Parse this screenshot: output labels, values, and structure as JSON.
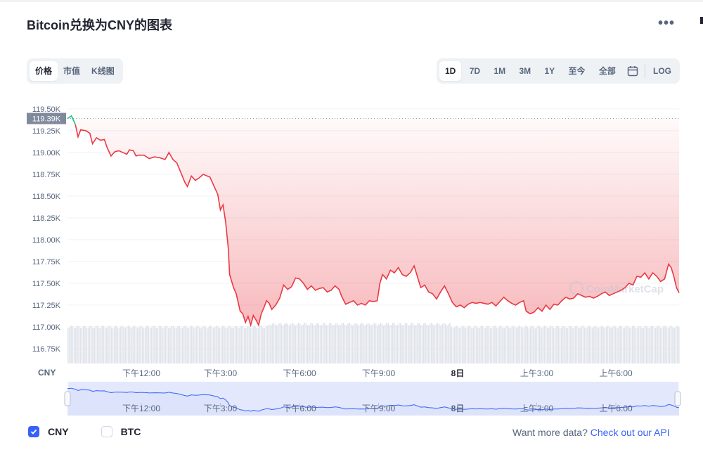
{
  "title": "Bitcoin兑换为CNY的图表",
  "menu_icon": "more-horizontal-icon",
  "metric_tabs": [
    "价格",
    "市值",
    "K线图"
  ],
  "active_metric": "价格",
  "range_tabs": [
    "1D",
    "7D",
    "1M",
    "3M",
    "1Y",
    "至今",
    "全部"
  ],
  "active_range": "1D",
  "calendar_icon": "calendar-icon",
  "log_label": "LOG",
  "chart_data": {
    "type": "area",
    "currency_label": "CNY",
    "y_ticks": [
      "119.50K",
      "119.25K",
      "119.00K",
      "118.75K",
      "118.50K",
      "118.25K",
      "118.00K",
      "117.75K",
      "117.50K",
      "117.25K",
      "117.00K",
      "116.75K"
    ],
    "ylim": [
      116.58,
      119.58
    ],
    "current_price_label": "119.39K",
    "current_price": 119.39,
    "x_ticks": [
      "下午12:00",
      "下午3:00",
      "下午6:00",
      "下午9:00",
      "8日",
      "上午3:00",
      "上午6:00"
    ],
    "x_range": [
      9.2,
      32.4
    ],
    "x_tick_values": [
      12,
      15,
      18,
      21,
      24,
      27,
      30
    ],
    "series": [
      {
        "name": "CNY",
        "points": [
          [
            9.2,
            119.39
          ],
          [
            9.35,
            119.42
          ],
          [
            9.5,
            119.32
          ],
          [
            9.6,
            119.18
          ],
          [
            9.7,
            119.26
          ],
          [
            9.9,
            119.25
          ],
          [
            10.05,
            119.22
          ],
          [
            10.15,
            119.1
          ],
          [
            10.3,
            119.17
          ],
          [
            10.45,
            119.14
          ],
          [
            10.6,
            119.15
          ],
          [
            10.7,
            119.06
          ],
          [
            10.85,
            118.96
          ],
          [
            11.0,
            119.01
          ],
          [
            11.15,
            119.02
          ],
          [
            11.3,
            119.0
          ],
          [
            11.45,
            118.98
          ],
          [
            11.55,
            119.03
          ],
          [
            11.7,
            119.02
          ],
          [
            11.8,
            118.96
          ],
          [
            11.9,
            118.97
          ],
          [
            12.1,
            118.97
          ],
          [
            12.3,
            118.93
          ],
          [
            12.5,
            118.95
          ],
          [
            12.7,
            118.94
          ],
          [
            12.9,
            118.92
          ],
          [
            13.05,
            119.0
          ],
          [
            13.2,
            118.92
          ],
          [
            13.35,
            118.88
          ],
          [
            13.5,
            118.77
          ],
          [
            13.65,
            118.66
          ],
          [
            13.75,
            118.61
          ],
          [
            13.9,
            118.73
          ],
          [
            14.05,
            118.68
          ],
          [
            14.2,
            118.71
          ],
          [
            14.35,
            118.75
          ],
          [
            14.5,
            118.73
          ],
          [
            14.6,
            118.72
          ],
          [
            14.75,
            118.62
          ],
          [
            14.9,
            118.52
          ],
          [
            15.0,
            118.34
          ],
          [
            15.1,
            118.4
          ],
          [
            15.2,
            118.2
          ],
          [
            15.3,
            117.9
          ],
          [
            15.35,
            117.6
          ],
          [
            15.5,
            117.45
          ],
          [
            15.6,
            117.38
          ],
          [
            15.75,
            117.18
          ],
          [
            15.85,
            117.15
          ],
          [
            15.95,
            117.05
          ],
          [
            16.05,
            117.12
          ],
          [
            16.15,
            117.02
          ],
          [
            16.25,
            117.13
          ],
          [
            16.35,
            117.08
          ],
          [
            16.45,
            117.02
          ],
          [
            16.55,
            117.15
          ],
          [
            16.65,
            117.22
          ],
          [
            16.75,
            117.3
          ],
          [
            16.85,
            117.27
          ],
          [
            16.95,
            117.2
          ],
          [
            17.1,
            117.25
          ],
          [
            17.25,
            117.33
          ],
          [
            17.4,
            117.48
          ],
          [
            17.55,
            117.43
          ],
          [
            17.7,
            117.46
          ],
          [
            17.85,
            117.56
          ],
          [
            18.0,
            117.55
          ],
          [
            18.15,
            117.5
          ],
          [
            18.3,
            117.43
          ],
          [
            18.45,
            117.47
          ],
          [
            18.6,
            117.42
          ],
          [
            18.75,
            117.44
          ],
          [
            18.9,
            117.45
          ],
          [
            19.05,
            117.4
          ],
          [
            19.2,
            117.42
          ],
          [
            19.35,
            117.47
          ],
          [
            19.5,
            117.43
          ],
          [
            19.6,
            117.35
          ],
          [
            19.75,
            117.26
          ],
          [
            19.9,
            117.28
          ],
          [
            20.05,
            117.3
          ],
          [
            20.2,
            117.25
          ],
          [
            20.35,
            117.27
          ],
          [
            20.5,
            117.25
          ],
          [
            20.65,
            117.3
          ],
          [
            20.8,
            117.29
          ],
          [
            20.95,
            117.3
          ],
          [
            21.05,
            117.5
          ],
          [
            21.15,
            117.6
          ],
          [
            21.3,
            117.55
          ],
          [
            21.45,
            117.65
          ],
          [
            21.6,
            117.62
          ],
          [
            21.75,
            117.68
          ],
          [
            21.9,
            117.6
          ],
          [
            22.05,
            117.58
          ],
          [
            22.2,
            117.62
          ],
          [
            22.35,
            117.7
          ],
          [
            22.5,
            117.55
          ],
          [
            22.6,
            117.45
          ],
          [
            22.75,
            117.48
          ],
          [
            22.9,
            117.4
          ],
          [
            23.05,
            117.38
          ],
          [
            23.2,
            117.32
          ],
          [
            23.35,
            117.4
          ],
          [
            23.5,
            117.47
          ],
          [
            23.65,
            117.38
          ],
          [
            23.8,
            117.28
          ],
          [
            23.95,
            117.23
          ],
          [
            24.1,
            117.25
          ],
          [
            24.25,
            117.22
          ],
          [
            24.4,
            117.26
          ],
          [
            24.55,
            117.28
          ],
          [
            24.7,
            117.27
          ],
          [
            24.85,
            117.28
          ],
          [
            25.0,
            117.27
          ],
          [
            25.15,
            117.26
          ],
          [
            25.3,
            117.28
          ],
          [
            25.45,
            117.24
          ],
          [
            25.6,
            117.29
          ],
          [
            25.75,
            117.34
          ],
          [
            25.9,
            117.3
          ],
          [
            26.05,
            117.27
          ],
          [
            26.2,
            117.25
          ],
          [
            26.35,
            117.28
          ],
          [
            26.5,
            117.3
          ],
          [
            26.6,
            117.18
          ],
          [
            26.75,
            117.15
          ],
          [
            26.9,
            117.17
          ],
          [
            27.05,
            117.22
          ],
          [
            27.2,
            117.18
          ],
          [
            27.35,
            117.25
          ],
          [
            27.5,
            117.2
          ],
          [
            27.65,
            117.26
          ],
          [
            27.8,
            117.25
          ],
          [
            27.95,
            117.3
          ],
          [
            28.1,
            117.34
          ],
          [
            28.25,
            117.32
          ],
          [
            28.4,
            117.33
          ],
          [
            28.55,
            117.38
          ],
          [
            28.7,
            117.36
          ],
          [
            28.85,
            117.34
          ],
          [
            29.0,
            117.35
          ],
          [
            29.15,
            117.33
          ],
          [
            29.3,
            117.35
          ],
          [
            29.45,
            117.38
          ],
          [
            29.6,
            117.4
          ],
          [
            29.75,
            117.36
          ],
          [
            29.9,
            117.38
          ],
          [
            30.05,
            117.4
          ],
          [
            30.2,
            117.42
          ],
          [
            30.35,
            117.45
          ],
          [
            30.5,
            117.5
          ],
          [
            30.65,
            117.48
          ],
          [
            30.8,
            117.58
          ],
          [
            30.95,
            117.57
          ],
          [
            31.1,
            117.62
          ],
          [
            31.25,
            117.55
          ],
          [
            31.4,
            117.62
          ],
          [
            31.55,
            117.58
          ],
          [
            31.7,
            117.52
          ],
          [
            31.85,
            117.55
          ],
          [
            32.0,
            117.72
          ],
          [
            32.1,
            117.68
          ],
          [
            32.2,
            117.58
          ],
          [
            32.3,
            117.45
          ],
          [
            32.4,
            117.39
          ]
        ]
      }
    ],
    "up_color": "#16c784",
    "down_color": "#ea3943",
    "grid": true,
    "volume_bars": true,
    "watermark": "CoinMarketCap"
  },
  "legend": [
    {
      "label": "CNY",
      "checked": true
    },
    {
      "label": "BTC",
      "checked": false
    }
  ],
  "footer": {
    "text": "Want more data? ",
    "link": "Check out our API"
  }
}
